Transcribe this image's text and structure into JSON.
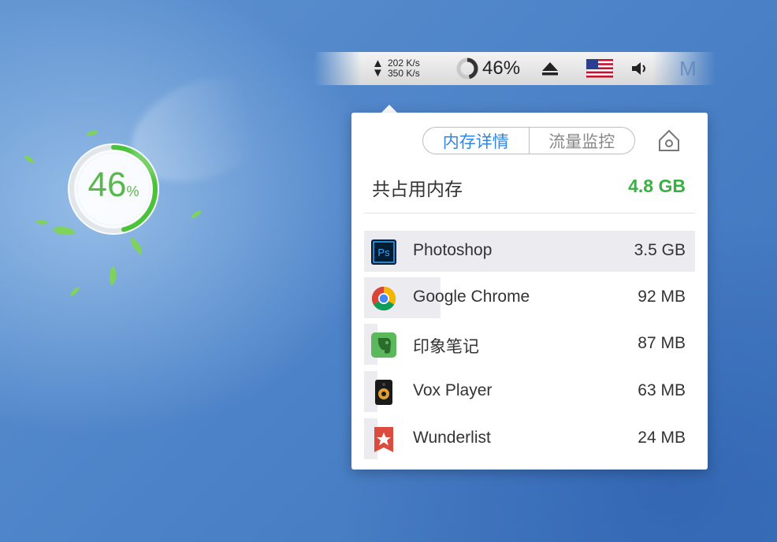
{
  "desktop_widget": {
    "percent_value": "46",
    "percent_sign": "%"
  },
  "menubar": {
    "upload_speed": "202 K/s",
    "download_speed": "350 K/s",
    "cpu_percent": "46%",
    "partial_text": "M"
  },
  "popover": {
    "tabs": [
      {
        "label": "内存详情",
        "active": true
      },
      {
        "label": "流量监控",
        "active": false
      }
    ],
    "total_label": "共占用内存",
    "total_value": "4.8 GB",
    "apps": [
      {
        "name": "Photoshop",
        "size": "3.5 GB",
        "icon": "photoshop-icon",
        "usage_fraction": 1.0
      },
      {
        "name": "Google Chrome",
        "size": "92 MB",
        "icon": "chrome-icon",
        "usage_fraction": 0.23
      },
      {
        "name": "印象笔记",
        "size": "87 MB",
        "icon": "evernote-icon",
        "usage_fraction": 0.04
      },
      {
        "name": "Vox Player",
        "size": "63 MB",
        "icon": "vox-player-icon",
        "usage_fraction": 0.03
      },
      {
        "name": "Wunderlist",
        "size": "24 MB",
        "icon": "wunderlist-icon",
        "usage_fraction": 0.02
      }
    ]
  },
  "colors": {
    "accent_blue": "#2f85e8",
    "total_green": "#39b043",
    "ring_green": "#4cc23a"
  }
}
